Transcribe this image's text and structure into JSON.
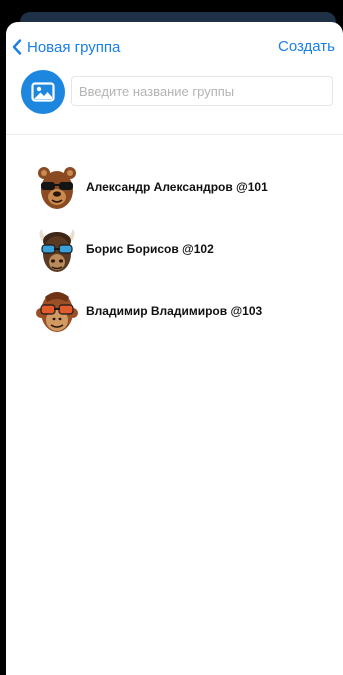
{
  "header": {
    "back_label": "Новая группа",
    "create_label": "Создать"
  },
  "group": {
    "name_placeholder": "Введите название группы",
    "name_value": ""
  },
  "members": [
    {
      "name": "Александр Александров @101",
      "avatar": "brown-bear-sunglasses-icon",
      "fur": "#8a4a22",
      "face": "#c88a4f"
    },
    {
      "name": "Борис Борисов @102",
      "avatar": "bison-sunglasses-icon",
      "fur": "#5b3a24",
      "face": "#b98a5a"
    },
    {
      "name": "Владимир Владимиров @103",
      "avatar": "monkey-sunglasses-icon",
      "fur": "#9a4f26",
      "face": "#d19a62"
    }
  ],
  "colors": {
    "accent": "#1a7ee8",
    "photo_button": "#1d87e0"
  }
}
